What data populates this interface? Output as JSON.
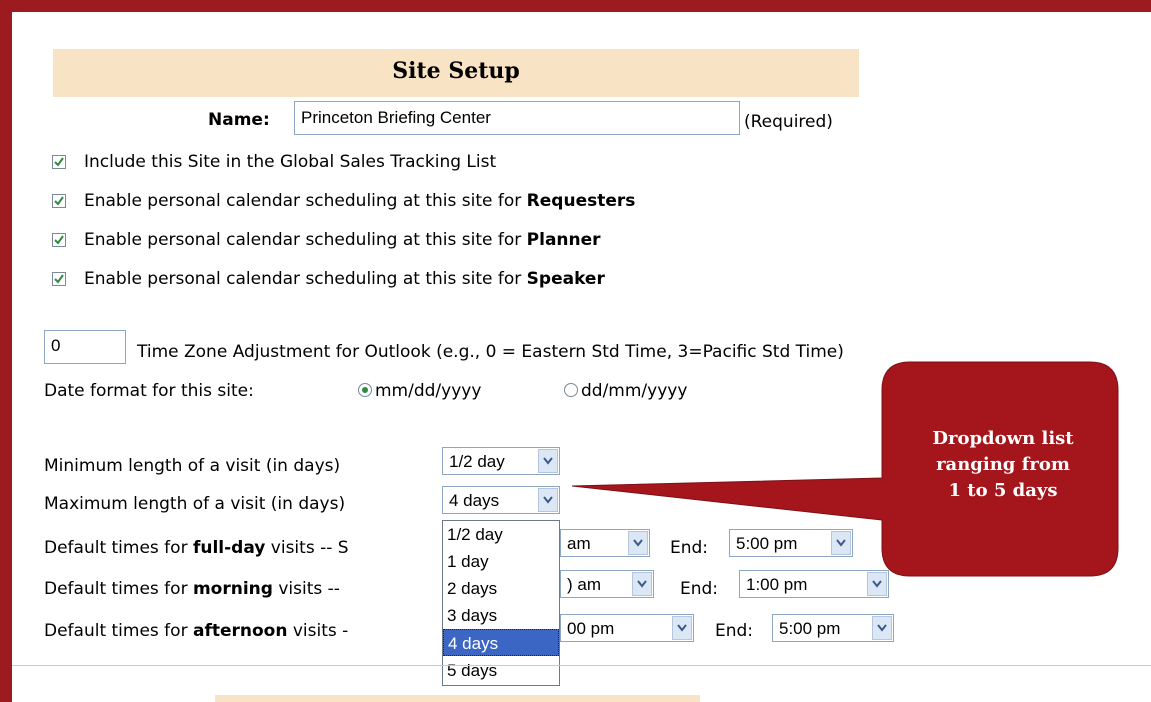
{
  "page": {
    "title": "Site Setup"
  },
  "name_field": {
    "label": "Name:",
    "value": "Princeton Briefing Center",
    "required": "(Required)"
  },
  "checkboxes": [
    {
      "text": "Include this Site in the Global Sales Tracking List",
      "bold": "",
      "checked": true
    },
    {
      "text": "Enable personal calendar scheduling at this site for ",
      "bold": "Requesters",
      "checked": true
    },
    {
      "text": "Enable personal calendar scheduling at this site for ",
      "bold": "Planner",
      "checked": true
    },
    {
      "text": "Enable personal calendar scheduling at this site for ",
      "bold": "Speaker",
      "checked": true
    }
  ],
  "timezone": {
    "value": "0",
    "label": "Time Zone Adjustment for Outlook (e.g., 0 = Eastern Std Time, 3=Pacific Std Time)"
  },
  "date_format": {
    "label": "Date format for this site:",
    "options": [
      "mm/dd/yyyy",
      "dd/mm/yyyy"
    ],
    "selected": "mm/dd/yyyy"
  },
  "visit_length": {
    "min_label": "Minimum length of a visit (in days)",
    "min_value": "1/2 day",
    "max_label": "Maximum length of a visit (in days)",
    "max_value": "4 days"
  },
  "default_times": {
    "full_day": {
      "prefix": "Default times for ",
      "bold": "full-day",
      "suffix": " visits -- S",
      "start_partial": "am",
      "end_label": "End:",
      "end_value": "5:00 pm"
    },
    "morning": {
      "prefix": "Default times for ",
      "bold": "morning",
      "suffix": " visits -- ",
      "start_partial": ") am",
      "end_label": "End:",
      "end_value": "1:00 pm"
    },
    "afternoon": {
      "prefix": "Default times for ",
      "bold": "afternoon",
      "suffix": " visits -",
      "start_partial": "00 pm",
      "end_label": "End:",
      "end_value": "5:00 pm"
    }
  },
  "dropdown": {
    "options": [
      "1/2 day",
      "1 day",
      "2 days",
      "3 days",
      "4 days",
      "5 days"
    ],
    "selected_index": 4
  },
  "callout": {
    "lines": [
      "Dropdown list",
      "ranging from",
      "1 to 5 days"
    ],
    "color": "#a4161c"
  },
  "colors": {
    "frame": "#9b1b1f",
    "header_band": "#f9e3c5",
    "selection": "#3b66c4",
    "check": "#2d8a3f"
  }
}
